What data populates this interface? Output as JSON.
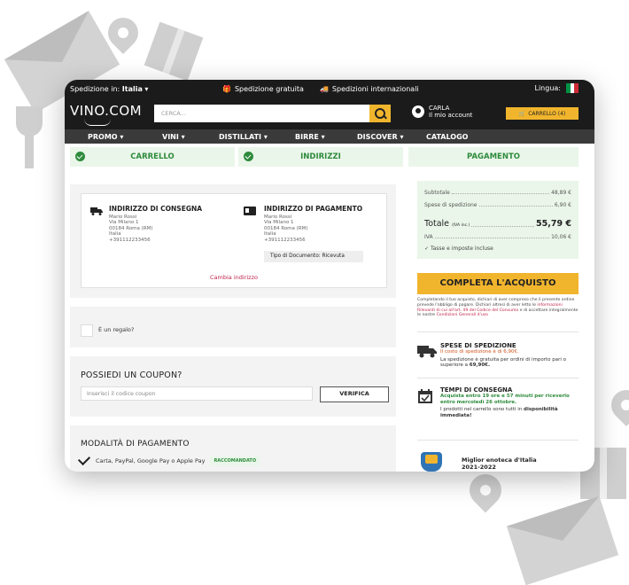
{
  "topbar": {
    "shipping_in_label": "Spedizione in:",
    "shipping_in_country": "Italia",
    "free_shipping": "Spedizione gratuita",
    "intl_shipping": "Spedizioni internazionali",
    "language_label": "Lingua:"
  },
  "header": {
    "logo": "VINO.COM",
    "search_placeholder": "CERCA...",
    "account_name": "CARLA",
    "account_label": "Il mio account",
    "cart_label": "CARRELLO (4)"
  },
  "nav": {
    "items": [
      "PROMO",
      "VINI",
      "DISTILLATI",
      "BIRRE",
      "DISCOVER",
      "CATALOGO"
    ]
  },
  "steps": [
    {
      "label": "CARRELLO",
      "done": true
    },
    {
      "label": "INDIRIZZI",
      "done": true
    },
    {
      "label": "PAGAMENTO",
      "done": false
    }
  ],
  "addresses": {
    "shipping": {
      "title": "INDIRIZZO DI CONSEGNA",
      "lines": [
        "Mario Rossi",
        "Via Milano 1",
        "00184 Roma (RM)",
        "Italia",
        "+391112233456"
      ]
    },
    "billing": {
      "title": "INDIRIZZO DI PAGAMENTO",
      "lines": [
        "Mario Rossi",
        "Via Milano 1",
        "00184 Roma (RM)",
        "Italia",
        "+391112233456"
      ]
    },
    "doc_type": "Tipo di Documento: Ricevuta",
    "change_link": "Cambia indirizzo"
  },
  "gift": {
    "label": "È un regalo?"
  },
  "coupon": {
    "title": "POSSIEDI UN COUPON?",
    "placeholder": "Inserisci il codice coupon",
    "verify_label": "VERIFICA"
  },
  "payment": {
    "title": "MODALITÀ DI PAGAMENTO",
    "option": "Carta, PayPal, Google Pay o Apple Pay",
    "badge": "RACCOMANDATO"
  },
  "summary": {
    "subtotal_label": "Subtotale",
    "subtotal": "48,89 €",
    "shipping_label": "Spese di spedizione",
    "shipping": "6,90 €",
    "total_label": "Totale",
    "total_note": "(IVA inc.)",
    "total": "55,79 €",
    "vat_label": "IVA",
    "vat": "10,06 €",
    "taxes_note": "Tasse e imposte incluse"
  },
  "checkout": {
    "button": "COMPLETA L'ACQUISTO",
    "legal_1": "Completando il tuo acquisto, dichiari di aver compreso che il presente ordine prevede l'obbligo di pagare. Dichiari altresì di aver letto le ",
    "legal_link1": "informazioni Rilevanti di cui all'art. 49 del Codice del Consumo",
    "legal_2": " e di accettare integralmente le nostre ",
    "legal_link2": "Condizioni Generali d'uso"
  },
  "shipping_info": {
    "title": "SPESE DI SPEDIZIONE",
    "cost": "Il costo di spedizione è di 6,90€.",
    "free_text": "La spedizione è gratuita per ordini di importo pari o superiore a ",
    "free_amount": "69,90€."
  },
  "delivery_info": {
    "title": "TEMPI DI CONSEGNA",
    "when": "Acquista entro 19 ore e 57 minuti per riceverlo entro mercoledì 26 ottobre.",
    "availability_text": "I prodotti nel carrello sono tutti in ",
    "availability_bold": "disponibilità immediata!"
  },
  "award": {
    "line1": "Miglior enoteca d'Italia",
    "line2": "2021-2022"
  },
  "colors": {
    "accent": "#f1b52d",
    "dark": "#1b1b1b",
    "green": "#2e8b3c",
    "green_bg": "#eaf6ea",
    "link_red": "#c2244b"
  }
}
